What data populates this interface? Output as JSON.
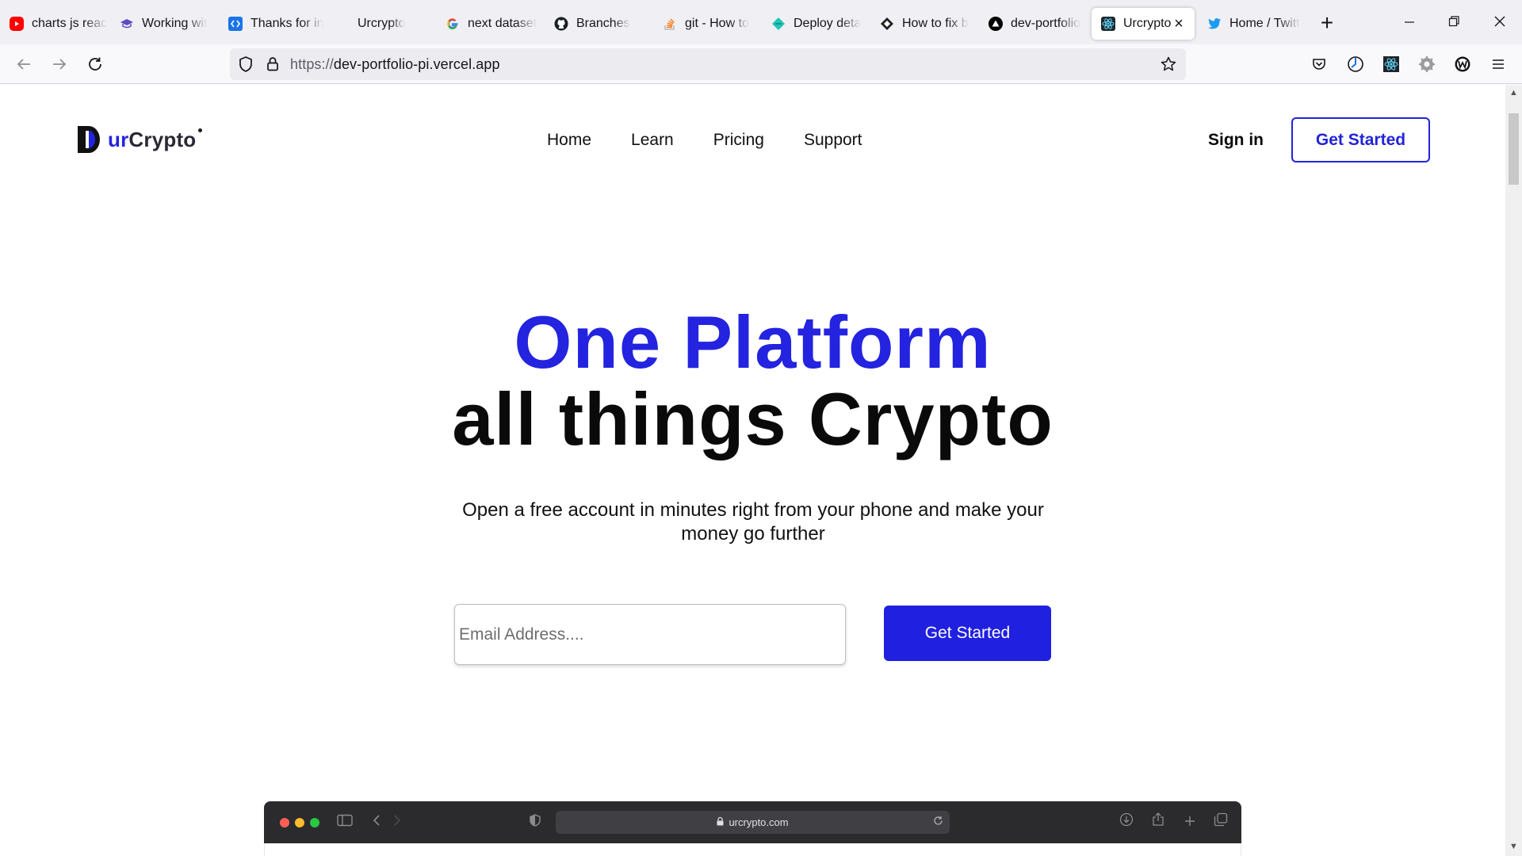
{
  "browser": {
    "tabs": [
      {
        "title": "charts js reac",
        "icon": "youtube-icon",
        "color": "#ff0000"
      },
      {
        "title": "Working wit",
        "icon": "graduation-cap-icon",
        "color": "#5b4cc4"
      },
      {
        "title": "Thanks for in",
        "icon": "code-brackets-icon",
        "color": "#1a73e8"
      },
      {
        "title": "Urcrypto",
        "icon": "",
        "color": ""
      },
      {
        "title": "next dataset",
        "icon": "google-icon",
        "color": "#4285f4"
      },
      {
        "title": "Branches",
        "icon": "github-icon",
        "color": "#1b1f23"
      },
      {
        "title": "git - How to",
        "icon": "stackoverflow-icon",
        "color": "#f48024"
      },
      {
        "title": "Deploy deta",
        "icon": "netlify-icon",
        "color": "#20c6b7"
      },
      {
        "title": "How to fix b",
        "icon": "diamond-icon",
        "color": "#222222"
      },
      {
        "title": "dev-portfolio",
        "icon": "vercel-icon",
        "color": "#000000"
      },
      {
        "title": "Urcrypto",
        "icon": "react-icon",
        "color": "#1f2a30"
      },
      {
        "title": "Home / Twitt",
        "icon": "twitter-icon",
        "color": "#1d9bf0"
      }
    ],
    "url": {
      "scheme": "https://",
      "host": "dev-portfolio-pi.vercel.app"
    }
  },
  "site": {
    "logo": {
      "prefix": "ur",
      "suffix": "Crypto"
    },
    "nav": [
      "Home",
      "Learn",
      "Pricing",
      "Support"
    ],
    "sign_in": "Sign in",
    "cta_top": "Get Started",
    "hero_line1": "One Platform",
    "hero_line2": "all things Crypto",
    "subtitle": "Open a free account in minutes right from your phone and make your money go further",
    "email_placeholder": "Email Address....",
    "cta_main": "Get Started",
    "mock_url": "urcrypto.com"
  },
  "colors": {
    "brand": "#2323e0",
    "text": "#0a0a0a"
  }
}
